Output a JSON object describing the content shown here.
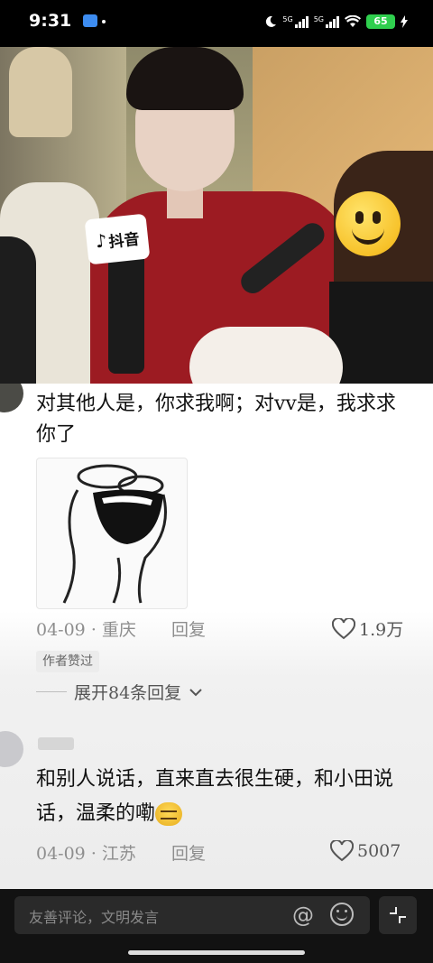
{
  "status_bar": {
    "time": "9:31",
    "network_1": "5G",
    "network_2": "5G",
    "battery": "65",
    "icons": [
      "app-notification-icon",
      "do-not-disturb-icon",
      "signal-icon",
      "wifi-icon",
      "battery-icon",
      "charging-icon"
    ]
  },
  "video": {
    "watermark_text": "抖音",
    "watermark_icon": "douyin-note-icon",
    "face_cover_icon": "smiley-emoji-icon"
  },
  "comments": [
    {
      "text": "对其他人是，你求我啊；对vv是，我求求\n你了",
      "sticker": "laughing-cartoon-sticker",
      "date": "04-09",
      "location": "重庆",
      "reply_label": "回复",
      "likes": "1.9万",
      "author_badge": "作者赞过",
      "expand_label": "展开84条回复"
    },
    {
      "text": "和别人说话，直来直去很生硬，和小田说\n话，温柔的嘞",
      "date": "04-09",
      "location": "江苏",
      "reply_label": "回复",
      "likes": "5007"
    }
  ],
  "input": {
    "placeholder": "友善评论，文明发言"
  },
  "colors": {
    "badge_bg": "#ececec",
    "battery": "#2fcf4e",
    "shirt": "#9c1b22"
  }
}
